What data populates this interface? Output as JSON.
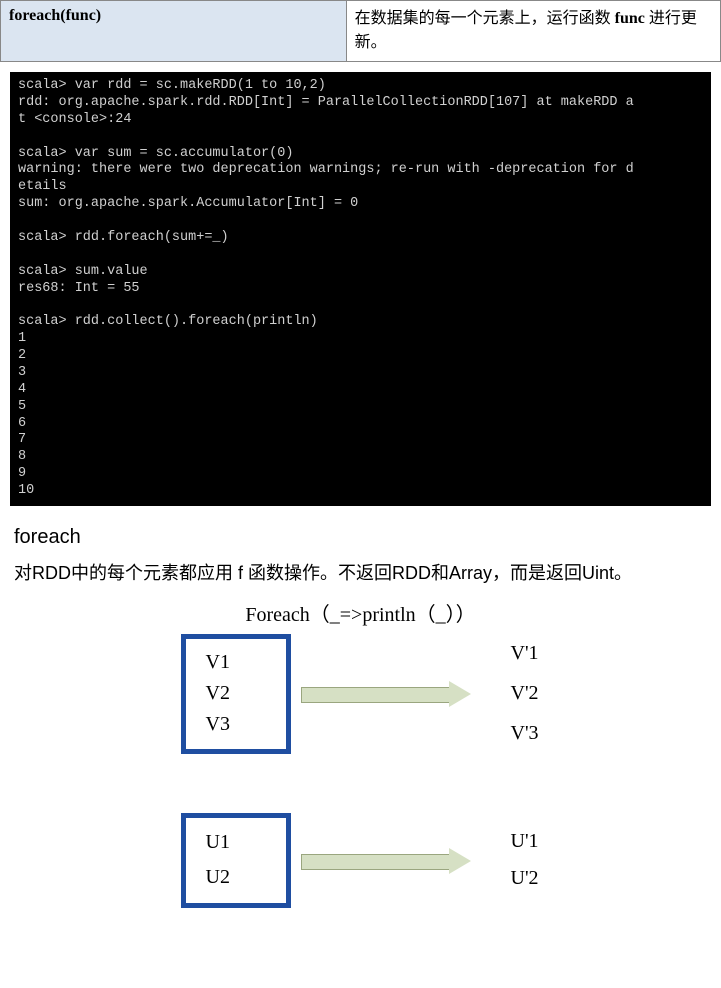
{
  "table": {
    "left": "foreach(func)",
    "right_pre": "在数据集的每一个元素上，运行函数",
    "right_bold": "func",
    "right_post": " 进行更新。"
  },
  "terminal": {
    "text": "scala> var rdd = sc.makeRDD(1 to 10,2)\nrdd: org.apache.spark.rdd.RDD[Int] = ParallelCollectionRDD[107] at makeRDD a\nt <console>:24\n\nscala> var sum = sc.accumulator(0)\nwarning: there were two deprecation warnings; re-run with -deprecation for d\netails\nsum: org.apache.spark.Accumulator[Int] = 0\n\nscala> rdd.foreach(sum+=_)\n\nscala> sum.value\nres68: Int = 55\n\nscala> rdd.collect().foreach(println)\n1\n2\n3\n4\n5\n6\n7\n8\n9\n10"
  },
  "section": {
    "title": "foreach",
    "desc": "对RDD中的每个元素都应用 f 函数操作。不返回RDD和Array，而是返回Uint。"
  },
  "diagram": {
    "caption": "Foreach（_=>println（_））",
    "box1": [
      "V1",
      "V2",
      "V3"
    ],
    "out1": [
      "V'1",
      "V'2",
      "V'3"
    ],
    "box2": [
      "U1",
      "U2"
    ],
    "out2": [
      "U'1",
      "U'2"
    ]
  }
}
